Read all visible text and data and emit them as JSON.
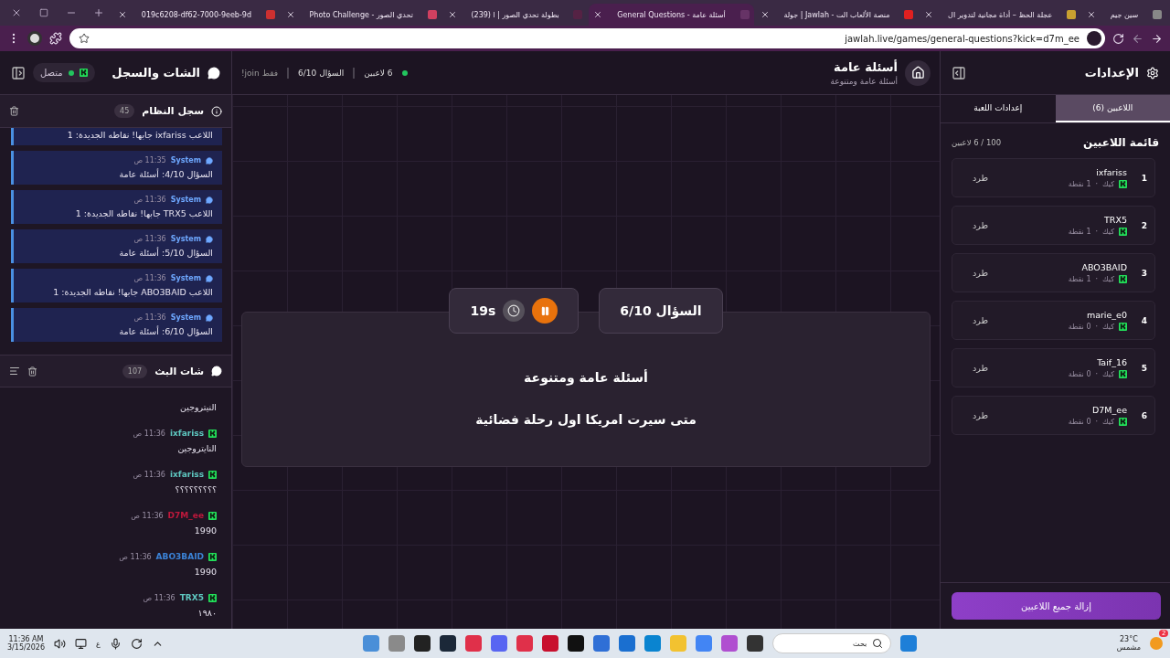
{
  "browser": {
    "tabs": [
      {
        "title": "سين جيم",
        "selected": false
      },
      {
        "title": "عجلة الحظ – أداة مجانية لتدوير ال",
        "selected": false
      },
      {
        "title": "جولة | Jawlah - منصة الألعاب الت",
        "selected": false
      },
      {
        "title": "General Questions - أسئلة عامة",
        "selected": true
      },
      {
        "title": "(239) بطولة تحدي الصور | ا",
        "selected": false
      },
      {
        "title": "Photo Challenge - تحدي الصور",
        "selected": false
      },
      {
        "title": "019c6208-df62-7000-9eeb-9d",
        "selected": false
      }
    ],
    "url": "jawlah.live/games/general-questions?kick=d7m_ee"
  },
  "chat_panel": {
    "title": "الشات والسجل",
    "status": {
      "label": "متصل",
      "online": true
    },
    "system_log": {
      "title": "سجل النظام",
      "count": "45",
      "messages": [
        {
          "text": "اللاعب ixfariss جابها! نقاطه الجديدة: 1"
        },
        {
          "sender": "System",
          "time": "11:35 ص",
          "text": "السؤال 4/10: أسئلة عامة"
        },
        {
          "sender": "System",
          "time": "11:36 ص",
          "text": "اللاعب TRX5 جابها! نقاطه الجديدة: 1"
        },
        {
          "sender": "System",
          "time": "11:36 ص",
          "text": "السؤال 5/10: أسئلة عامة"
        },
        {
          "sender": "System",
          "time": "11:36 ص",
          "text": "اللاعب ABO3BAID جابها! نقاطه الجديدة: 1"
        },
        {
          "sender": "System",
          "time": "11:36 ص",
          "text": "السؤال 6/10: أسئلة عامة"
        }
      ]
    },
    "stream_chat": {
      "title": "شات البث",
      "count": "107",
      "messages": [
        {
          "text": "النيتروجين"
        },
        {
          "user": "ixfariss",
          "time": "11:36 ص",
          "text": "النايتروجين",
          "color": "#5ec7c0"
        },
        {
          "user": "ixfariss",
          "time": "11:36 ص",
          "text": "؟؟؟؟؟؟؟؟؟",
          "color": "#5ec7c0"
        },
        {
          "user": "D7M_ee",
          "time": "11:36 ص",
          "text": "1990",
          "color": "#c0183c"
        },
        {
          "user": "ABO3BAID",
          "time": "11:36 ص",
          "text": "1990",
          "color": "#3b82d6"
        },
        {
          "user": "TRX5",
          "time": "11:36 ص",
          "text": "١٩٨٠",
          "color": "#5ec7c0"
        }
      ]
    }
  },
  "game": {
    "title": "أسئلة عامة",
    "subtitle": "أسئلة عامة ومتنوعة",
    "players_online": "6 لاعبين",
    "question_progress": "السؤال 6/10",
    "join_hint": "فقط join!",
    "timer": "19s",
    "question_label": "السؤال 6/10",
    "category": "أسئلة عامة ومتنوعة",
    "question": "متى سيرت امريكا اول رحلة فضائية"
  },
  "settings": {
    "title": "الإعدادات",
    "tabs": [
      {
        "label": "اللاعبين (6)",
        "selected": true
      },
      {
        "label": "إعدادات اللعبة",
        "selected": false
      }
    ],
    "list_title": "قائمة اللاعبين",
    "capacity": "100 / 6 لاعبين",
    "players": [
      {
        "rank": "1",
        "name": "ixfariss",
        "platform": "كيك",
        "separator": "·",
        "points": "1 نقطة",
        "kick": "طرد"
      },
      {
        "rank": "2",
        "name": "TRX5",
        "platform": "كيك",
        "separator": "·",
        "points": "1 نقطة",
        "kick": "طرد"
      },
      {
        "rank": "3",
        "name": "ABO3BAID",
        "platform": "كيك",
        "separator": "·",
        "points": "1 نقطة",
        "kick": "طرد"
      },
      {
        "rank": "4",
        "name": "marie_e0",
        "platform": "كيك",
        "separator": "·",
        "points": "0 نقطة",
        "kick": "طرد"
      },
      {
        "rank": "5",
        "name": "Taif_16",
        "platform": "كيك",
        "separator": "·",
        "points": "0 نقطة",
        "kick": "طرد"
      },
      {
        "rank": "6",
        "name": "D7M_ee",
        "platform": "كيك",
        "separator": "·",
        "points": "0 نقطة",
        "kick": "طرد"
      }
    ],
    "remove_all": "إزالة جميع اللاعبين"
  },
  "taskbar": {
    "time": "11:36 AM",
    "date": "3/15/2026",
    "language": "ع",
    "search": "بحث",
    "temperature": "23°C",
    "weather": "مشمس",
    "badge": "2"
  }
}
